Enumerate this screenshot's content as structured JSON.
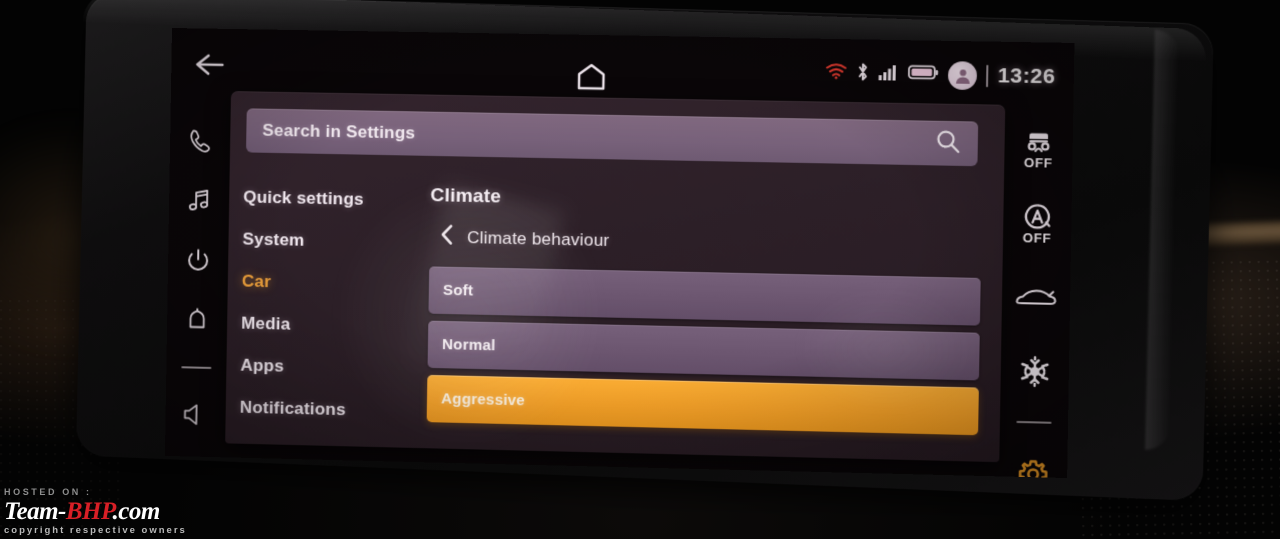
{
  "device": {
    "type": "car-infotainment-touchscreen",
    "accent_color": "#f5a128",
    "panel_color": "#2e2029",
    "option_row_color": "#6d5770"
  },
  "statusbar": {
    "back_icon": "back-arrow-icon",
    "home_icon": "home-icon",
    "wifi_icon": "wifi-off-icon",
    "bluetooth_icon": "bluetooth-icon",
    "signal_icon": "cellular-signal-icon",
    "battery_icon": "battery-icon",
    "avatar_icon": "user-avatar-icon",
    "time": "13:26"
  },
  "left_rail": {
    "items": [
      {
        "name": "phone-icon",
        "label": "Phone"
      },
      {
        "name": "music-note-icon",
        "label": "Media"
      },
      {
        "name": "power-icon",
        "label": "Power"
      },
      {
        "name": "bell-icon",
        "label": "Notifications"
      },
      {
        "name": "volume-icon",
        "label": "Volume"
      }
    ]
  },
  "right_rail": {
    "items": [
      {
        "name": "traction-control-off-icon",
        "label": "OFF",
        "sub": "Traction control"
      },
      {
        "name": "auto-start-stop-off-icon",
        "label": "OFF",
        "sub": "Auto start-stop"
      },
      {
        "name": "car-profile-icon",
        "label": "",
        "sub": "Vehicle"
      },
      {
        "name": "snowflake-icon",
        "label": "",
        "sub": "Air conditioning"
      },
      {
        "name": "gear-icon",
        "label": "",
        "sub": "Settings"
      }
    ]
  },
  "search": {
    "placeholder": "Search in Settings",
    "value": "",
    "icon": "search-icon"
  },
  "nav": {
    "items": [
      {
        "label": "Quick settings",
        "active": false
      },
      {
        "label": "System",
        "active": false
      },
      {
        "label": "Car",
        "active": true
      },
      {
        "label": "Media",
        "active": false
      },
      {
        "label": "Apps",
        "active": false
      },
      {
        "label": "Notifications",
        "active": false
      }
    ]
  },
  "detail": {
    "title": "Climate",
    "back_icon": "chevron-left-icon",
    "breadcrumb": "Climate behaviour",
    "options": [
      {
        "label": "Soft",
        "selected": false
      },
      {
        "label": "Normal",
        "selected": false
      },
      {
        "label": "Aggressive",
        "selected": true
      }
    ]
  },
  "watermark": {
    "hosted": "HOSTED ON :",
    "team": "Team-",
    "bhp": "BHP",
    "com": ".com",
    "copyright": "copyright respective owners"
  }
}
